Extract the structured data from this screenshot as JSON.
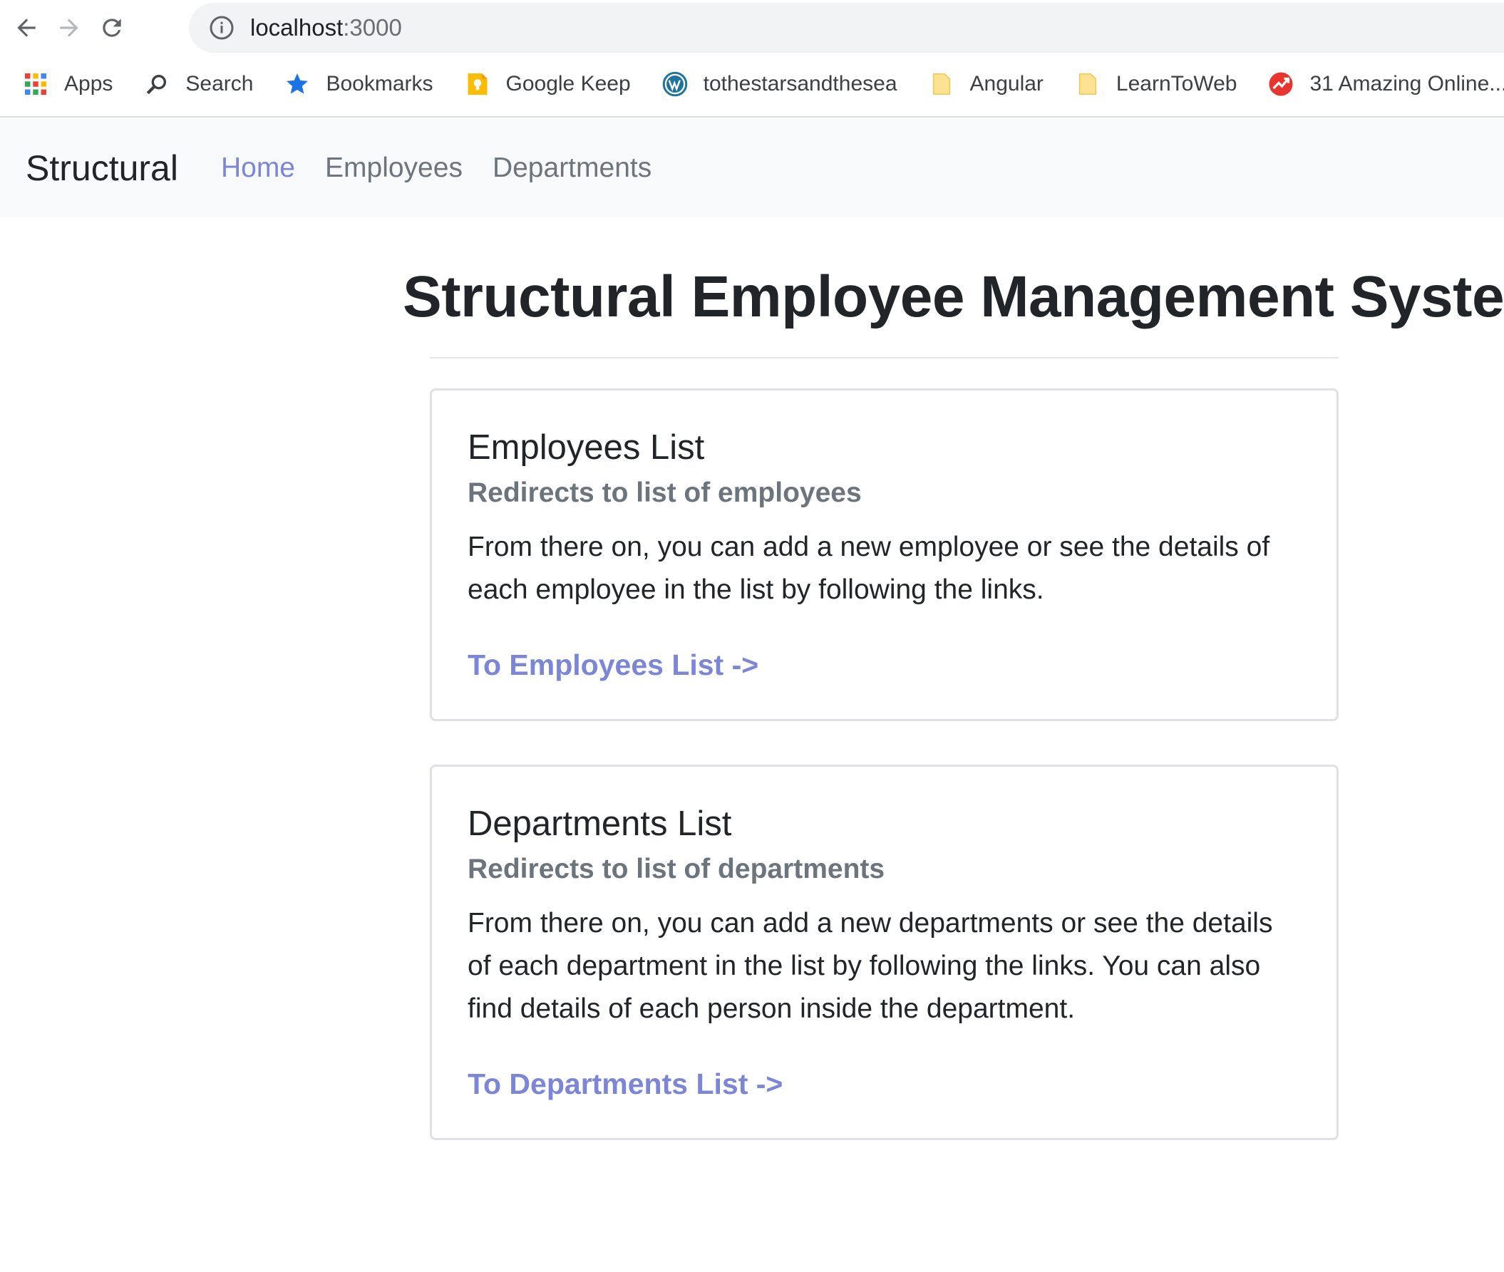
{
  "browser": {
    "url_host": "localhost",
    "url_port": ":3000",
    "bookmarks": [
      {
        "label": "Apps",
        "icon": "apps-grid-icon"
      },
      {
        "label": "Search",
        "icon": "search-icon"
      },
      {
        "label": "Bookmarks",
        "icon": "star-icon"
      },
      {
        "label": "Google Keep",
        "icon": "google-keep-icon"
      },
      {
        "label": "tothestarsandthesea",
        "icon": "wordpress-icon"
      },
      {
        "label": "Angular",
        "icon": "folder-icon"
      },
      {
        "label": "LearnToWeb",
        "icon": "folder-icon"
      },
      {
        "label": "31 Amazing Online...",
        "icon": "trending-icon"
      }
    ]
  },
  "navbar": {
    "brand": "Structural",
    "links": [
      {
        "label": "Home",
        "active": true
      },
      {
        "label": "Employees",
        "active": false
      },
      {
        "label": "Departments",
        "active": false
      }
    ]
  },
  "page": {
    "title": "Structural Employee Management System"
  },
  "cards": [
    {
      "title": "Employees List",
      "subtitle": "Redirects to list of employees",
      "text_lines": [
        "From there on, you can add a new employee or see the details of",
        "each employee in the list by following the links."
      ],
      "link": "To Employees List ->"
    },
    {
      "title": "Departments List",
      "subtitle": "Redirects to list of departments",
      "text_lines": [
        "From there on, you can add a new departments or see the details",
        "of each department in the list by following the links. You can also",
        "find details of each person inside the department."
      ],
      "link": "To Departments List ->"
    }
  ],
  "colors": {
    "accent": "#7b86d6",
    "muted": "#6c757d",
    "navbar_bg": "#f8f9fa"
  }
}
